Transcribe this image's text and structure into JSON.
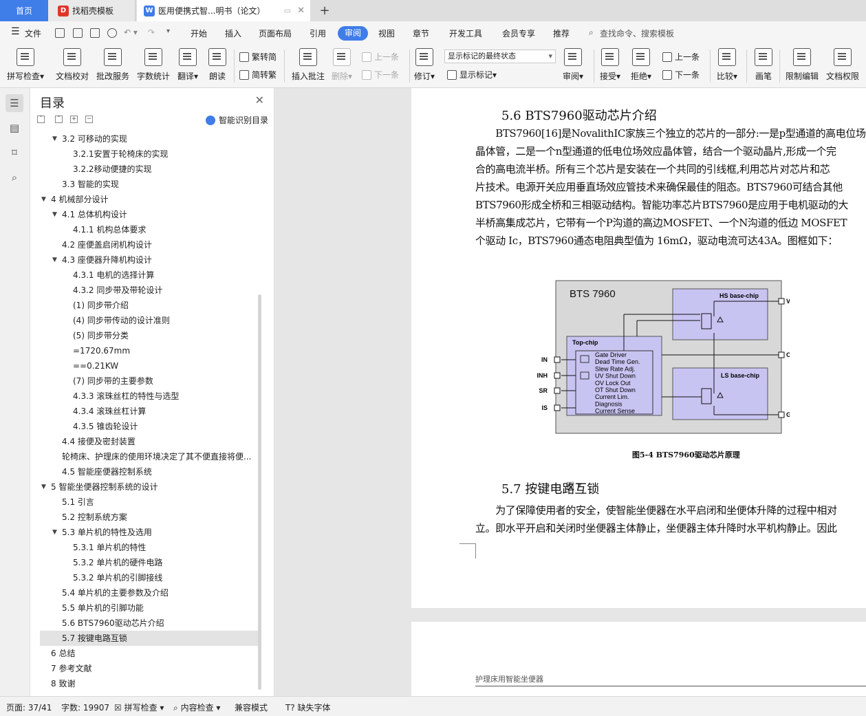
{
  "tabs": {
    "home": "首页",
    "template": "找稻壳模板",
    "document": "医用便携式智...明书（论文）",
    "add": "+"
  },
  "menu": {
    "file": "文件",
    "items": [
      "开始",
      "插入",
      "页面布局",
      "引用",
      "审阅",
      "视图",
      "章节",
      "开发工具",
      "会员专享",
      "推荐"
    ],
    "active": "审阅",
    "search": "查找命令、搜索模板"
  },
  "ribbon": {
    "spell": "拼写检查",
    "proof": "文档校对",
    "annotate": "批改服务",
    "wordcount": "字数统计",
    "translate": "翻译",
    "read": "朗读",
    "to_traditional": "繁转简",
    "to_simplified": "简转繁",
    "insert_comment": "插入批注",
    "delete": "删除",
    "prev": "上一条",
    "next": "下一条",
    "revise": "修订",
    "markup_select": "显示标记的最终状态",
    "show_markup": "显示标记",
    "review": "审阅",
    "accept": "接受",
    "reject": "拒绝",
    "prev2": "上一条",
    "next2": "下一条",
    "compare": "比较",
    "pen": "画笔",
    "restrict": "限制编辑",
    "permission": "文档权限"
  },
  "toc": {
    "title": "目录",
    "smart": "智能识别目录",
    "items": [
      {
        "label": "3.2 可移动的实现",
        "level": 2,
        "arrow": "v"
      },
      {
        "label": "3.2.1安置于轮椅床的实现",
        "level": 3
      },
      {
        "label": "3.2.2移动便捷的实现",
        "level": 3
      },
      {
        "label": "3.3 智能的实现",
        "level": 2
      },
      {
        "label": "4 机械部分设计",
        "level": 1,
        "arrow": "v"
      },
      {
        "label": "4.1 总体机构设计",
        "level": 2,
        "arrow": "v"
      },
      {
        "label": "4.1.1 机构总体要求",
        "level": 3
      },
      {
        "label": "4.2 座便盖启闭机构设计",
        "level": 2
      },
      {
        "label": "4.3 座便器升降机构设计",
        "level": 2,
        "arrow": "v"
      },
      {
        "label": "4.3.1 电机的选择计算",
        "level": 3
      },
      {
        "label": "4.3.2 同步带及带轮设计",
        "level": 3
      },
      {
        "label": "(1)  同步带介绍",
        "level": 3
      },
      {
        "label": "(4)   同步带传动的设计准则",
        "level": 3
      },
      {
        "label": "(5)   同步带分类",
        "level": 3
      },
      {
        "label": "=1720.67mm",
        "level": 3
      },
      {
        "label": "==0.21KW",
        "level": 3
      },
      {
        "label": "(7)  同步带的主要参数",
        "level": 3
      },
      {
        "label": "4.3.3 滚珠丝杠的特性与选型",
        "level": 3
      },
      {
        "label": "4.3.4 滚珠丝杠计算",
        "level": 3
      },
      {
        "label": "4.3.5 锥齿轮设计",
        "level": 3
      },
      {
        "label": "4.4 接便及密封装置",
        "level": 2
      },
      {
        "label": "轮椅床、护理床的使用环境决定了其不便直接将便...",
        "level": 2
      },
      {
        "label": "4.5 智能座便器控制系统",
        "level": 2
      },
      {
        "label": "5 智能坐便器控制系统的设计",
        "level": 1,
        "arrow": "v"
      },
      {
        "label": "5.1 引言",
        "level": 2
      },
      {
        "label": "5.2 控制系统方案",
        "level": 2
      },
      {
        "label": "5.3 单片机的特性及选用",
        "level": 2,
        "arrow": "v"
      },
      {
        "label": "5.3.1 单片机的特性",
        "level": 3
      },
      {
        "label": "5.3.2 单片机的硬件电路",
        "level": 3
      },
      {
        "label": "5.3.2 单片机的引脚接线",
        "level": 3
      },
      {
        "label": "5.4 单片机的主要参数及介绍",
        "level": 2
      },
      {
        "label": "5.5 单片机的引脚功能",
        "level": 2
      },
      {
        "label": "5.6 BTS7960驱动芯片介绍",
        "level": 2
      },
      {
        "label": "5.7 按键电路互锁",
        "level": 2,
        "selected": true
      },
      {
        "label": "6 总结",
        "level": 1
      },
      {
        "label": "7 参考文献",
        "level": 1
      },
      {
        "label": "8 致谢",
        "level": 1
      }
    ]
  },
  "document": {
    "heading1": "5.6 BTS7960驱动芯片介绍",
    "para1": [
      "　　BTS7960[16]是NovalithIC家族三个独立的芯片的一部分:一是p型通道的高电位场",
      "晶体管，二是一个n型通道的低电位场效应晶体管，结合一个驱动晶片,形成一个完",
      "合的高电流半桥。所有三个芯片是安装在一个共同的引线框,利用芯片对芯片和芯",
      "片技术。电源开关应用垂直场效应管技术来确保最佳的阻态。BTS7960可结合其他",
      "BTS7960形成全桥和三相驱动结构。智能功率芯片BTS7960是应用于电机驱动的大",
      "半桥高集成芯片，它带有一个P沟道的高边MOSFET、一个N沟道的低边 MOSFET",
      "个驱动 Ic，BTS7960通态电阻典型值为 16mΩ，驱动电流可达43A。图框如下："
    ],
    "figure": {
      "title": "BTS 7960",
      "hs": "HS base-chip",
      "ls": "LS base-chip",
      "top": "Top-chip",
      "funcs": [
        "Gate Driver",
        "Dead Time Gen.",
        "Slew Rate Adj.",
        "UV Shut Down",
        "OV Lock Out",
        "OT Shut Down",
        "Current Lim.",
        "Diagnosis",
        "Current Sense"
      ],
      "pins_left": [
        "IN",
        "INH",
        "SR",
        "IS"
      ],
      "pins_right": [
        "VS",
        "OUT",
        "GND"
      ]
    },
    "caption": "图5-4 BTS7960驱动芯片原理",
    "heading2": "5.7 按键电路互锁",
    "para2": [
      "　　为了保障使用者的安全，使智能坐便器在水平启闭和坐便体升降的过程中相对",
      "立。即水平开启和关闭时坐便器主体静止，坐便器主体升降时水平机构静止。因此"
    ],
    "page_header": "护理床用智能坐便器"
  },
  "status": {
    "page": "页面: 37/41",
    "words": "字数: 19907",
    "spell": "拼写检查",
    "content": "内容检查",
    "compat": "兼容模式",
    "font": "缺失字体"
  }
}
